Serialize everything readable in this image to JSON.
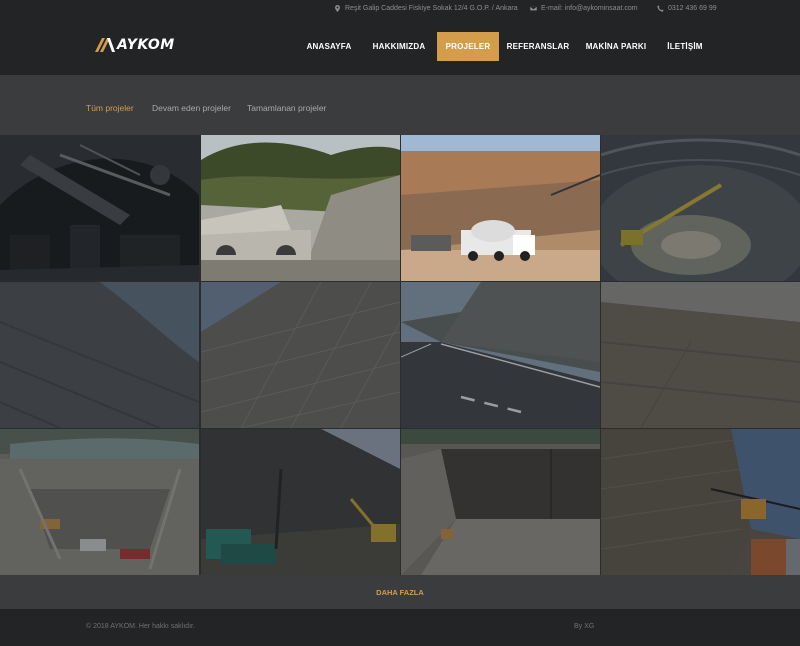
{
  "topbar": {
    "address": "Reşit Galip Caddesi Fiskiye Sokak 12/4 G.O.P. / Ankara",
    "email": "E-mail: info@aykominsaat.com",
    "phone": "0312 436 69 99"
  },
  "brand": {
    "name": "AYKOM",
    "accent": "#d39d4c"
  },
  "nav": {
    "items": [
      {
        "label": "ANASAYFA"
      },
      {
        "label": "HAKKIMIZDA"
      },
      {
        "label": "PROJELER"
      },
      {
        "label": "REFERANSLAR"
      },
      {
        "label": "MAKİNA PARKI"
      },
      {
        "label": "İLETİŞİM"
      }
    ],
    "active": "PROJELER"
  },
  "filters": {
    "items": [
      {
        "label": "Tüm projeler"
      },
      {
        "label": "Devam eden projeler"
      },
      {
        "label": "Tamamlanan projeler"
      }
    ],
    "active": "Tüm projeler"
  },
  "gallery": {
    "tiles": [
      {
        "icon": "tunnel-drill-photo"
      },
      {
        "icon": "tunnel-portal-photo"
      },
      {
        "icon": "concrete-mixer-photo"
      },
      {
        "icon": "shaft-excavation-photo"
      },
      {
        "icon": "rock-slope-photo"
      },
      {
        "icon": "mesh-slope-photo"
      },
      {
        "icon": "highway-slope-photo"
      },
      {
        "icon": "hillside-slope-photo"
      },
      {
        "icon": "excavation-site-photo"
      },
      {
        "icon": "drilling-rig-photo"
      },
      {
        "icon": "retaining-wall-photo"
      },
      {
        "icon": "crane-rock-face-photo"
      }
    ]
  },
  "more_label": "DAHA FAZLA",
  "footer": {
    "copyright": "© 2018 AYKOM. Her hakkı saklıdır.",
    "credit": "By XG"
  }
}
